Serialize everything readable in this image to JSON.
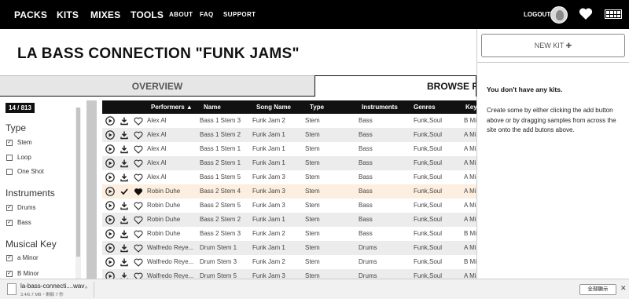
{
  "nav": {
    "packs": "PACKS",
    "kits": "KITS",
    "mixes": "MIXES",
    "tools": "TOOLS",
    "about": "ABOUT",
    "faq": "FAQ",
    "support": "SUPPORT",
    "logout": "LOGOUT"
  },
  "page": {
    "title": "LA BASS CONNECTION \"FUNK JAMS\"",
    "tab_overview": "OVERVIEW",
    "tab_browse": "BROWSE F"
  },
  "filters": {
    "count": "14 / 813",
    "type_heading": "Type",
    "type_options": [
      {
        "label": "Stem",
        "checked": true
      },
      {
        "label": "Loop",
        "checked": false
      },
      {
        "label": "One Shot",
        "checked": false
      }
    ],
    "instruments_heading": "Instruments",
    "instrument_options": [
      {
        "label": "Drums",
        "checked": true
      },
      {
        "label": "Bass",
        "checked": true
      }
    ],
    "key_heading": "Musical Key",
    "key_options": [
      {
        "label": "a Minor",
        "checked": true
      },
      {
        "label": "B Minor",
        "checked": true
      }
    ]
  },
  "table": {
    "headers": {
      "performers": "Performers ▲",
      "name": "Name",
      "song": "Song Name",
      "type": "Type",
      "instruments": "Instruments",
      "genres": "Genres",
      "key": "Key"
    },
    "rows": [
      {
        "performer": "Alex Al",
        "name": "Bass 1 Stem 3",
        "song": "Funk Jam 2",
        "type": "Stem",
        "instrument": "Bass",
        "genres": "Funk,Soul",
        "key": "B Mi"
      },
      {
        "performer": "Alex Al",
        "name": "Bass 1 Stem 2",
        "song": "Funk Jam 1",
        "type": "Stem",
        "instrument": "Bass",
        "genres": "Funk,Soul",
        "key": "A Mi"
      },
      {
        "performer": "Alex Al",
        "name": "Bass 1 Stem 1",
        "song": "Funk Jam 1",
        "type": "Stem",
        "instrument": "Bass",
        "genres": "Funk,Soul",
        "key": "A Mi"
      },
      {
        "performer": "Alex Al",
        "name": "Bass 2 Stem 1",
        "song": "Funk Jam 1",
        "type": "Stem",
        "instrument": "Bass",
        "genres": "Funk,Soul",
        "key": "A Mi"
      },
      {
        "performer": "Alex Al",
        "name": "Bass 1 Stem 5",
        "song": "Funk Jam 3",
        "type": "Stem",
        "instrument": "Bass",
        "genres": "Funk,Soul",
        "key": "A Mi"
      },
      {
        "performer": "Robin Duhe",
        "name": "Bass 2 Stem 4",
        "song": "Funk Jam 3",
        "type": "Stem",
        "instrument": "Bass",
        "genres": "Funk,Soul",
        "key": "A Mi"
      },
      {
        "performer": "Robin Duhe",
        "name": "Bass 2 Stem 5",
        "song": "Funk Jam 3",
        "type": "Stem",
        "instrument": "Bass",
        "genres": "Funk,Soul",
        "key": "A Mi"
      },
      {
        "performer": "Robin Duhe",
        "name": "Bass 2 Stem 2",
        "song": "Funk Jam 1",
        "type": "Stem",
        "instrument": "Bass",
        "genres": "Funk,Soul",
        "key": "A Mi"
      },
      {
        "performer": "Robin Duhe",
        "name": "Bass 2 Stem 3",
        "song": "Funk Jam 2",
        "type": "Stem",
        "instrument": "Bass",
        "genres": "Funk,Soul",
        "key": "B Mi"
      },
      {
        "performer": "Walfredo Reye...",
        "name": "Drum Stem 1",
        "song": "Funk Jam 1",
        "type": "Stem",
        "instrument": "Drums",
        "genres": "Funk,Soul",
        "key": "A Mi"
      },
      {
        "performer": "Walfredo Reye...",
        "name": "Drum Stem 3",
        "song": "Funk Jam 2",
        "type": "Stem",
        "instrument": "Drums",
        "genres": "Funk,Soul",
        "key": "B Mi"
      },
      {
        "performer": "Walfredo Reye...",
        "name": "Drum Stem 5",
        "song": "Funk Jam 3",
        "type": "Stem",
        "instrument": "Drums",
        "genres": "Funk,Soul",
        "key": "A Mi"
      }
    ]
  },
  "kits": {
    "new_kit_label": "NEW KIT ✚",
    "empty_title": "You don't have any kits.",
    "help_text": "Create some by either clicking the add button above or by dragging samples from across the site onto the add butons above."
  },
  "download": {
    "filename": "la-bass-connecti....wav",
    "status": "3.4/6.7 MB・剩餘 7 秒",
    "show_all": "全部顯示"
  }
}
